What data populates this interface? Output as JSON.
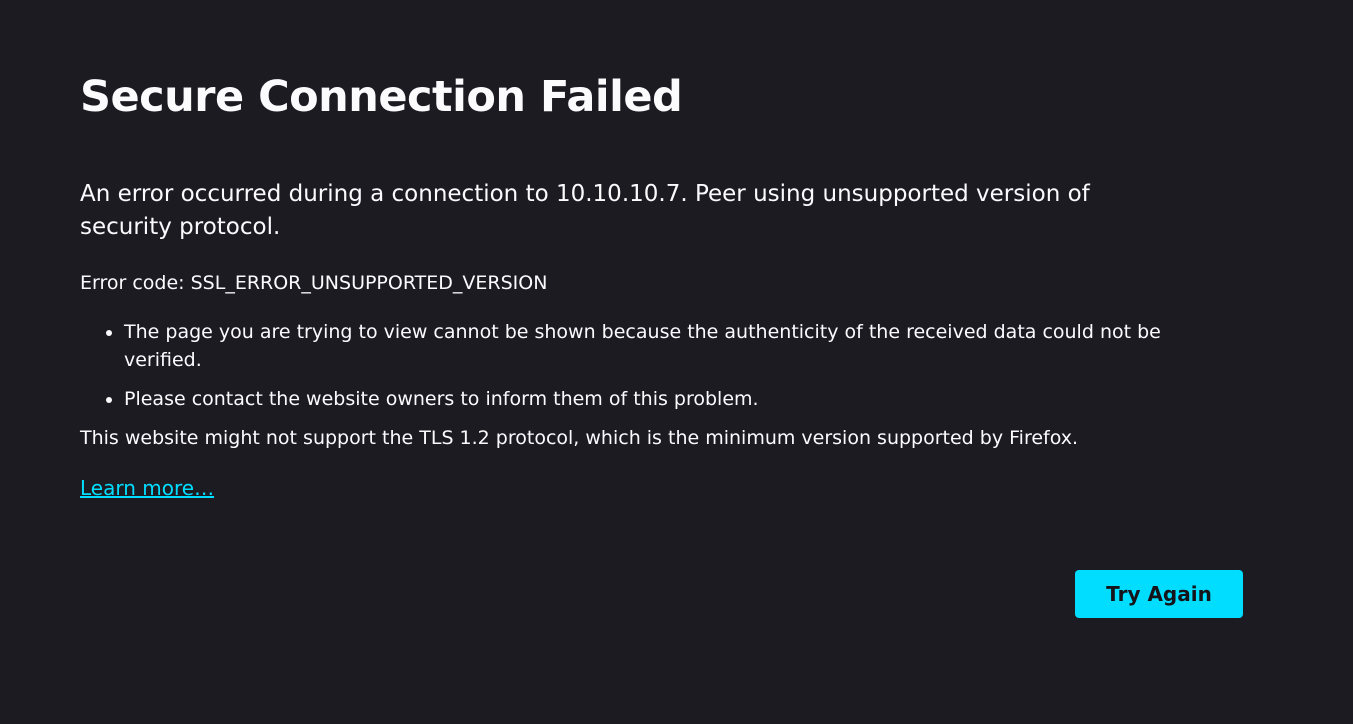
{
  "page": {
    "title": "Secure Connection Failed",
    "short_description": "An error occurred during a connection to 10.10.10.7. Peer using unsupported version of security protocol.",
    "error_code": "Error code: SSL_ERROR_UNSUPPORTED_VERSION",
    "details": [
      "The page you are trying to view cannot be shown because the authenticity of the received data could not be verified.",
      "Please contact the website owners to inform them of this problem."
    ],
    "tls_note": "This website might not support the TLS 1.2 protocol, which is the minimum version supported by Firefox.",
    "learn_more": "Learn more…",
    "try_again": "Try Again"
  },
  "colors": {
    "background": "#1c1b22",
    "text": "#fbfbfe",
    "accent": "#00ddff",
    "button_text": "#15141a"
  }
}
